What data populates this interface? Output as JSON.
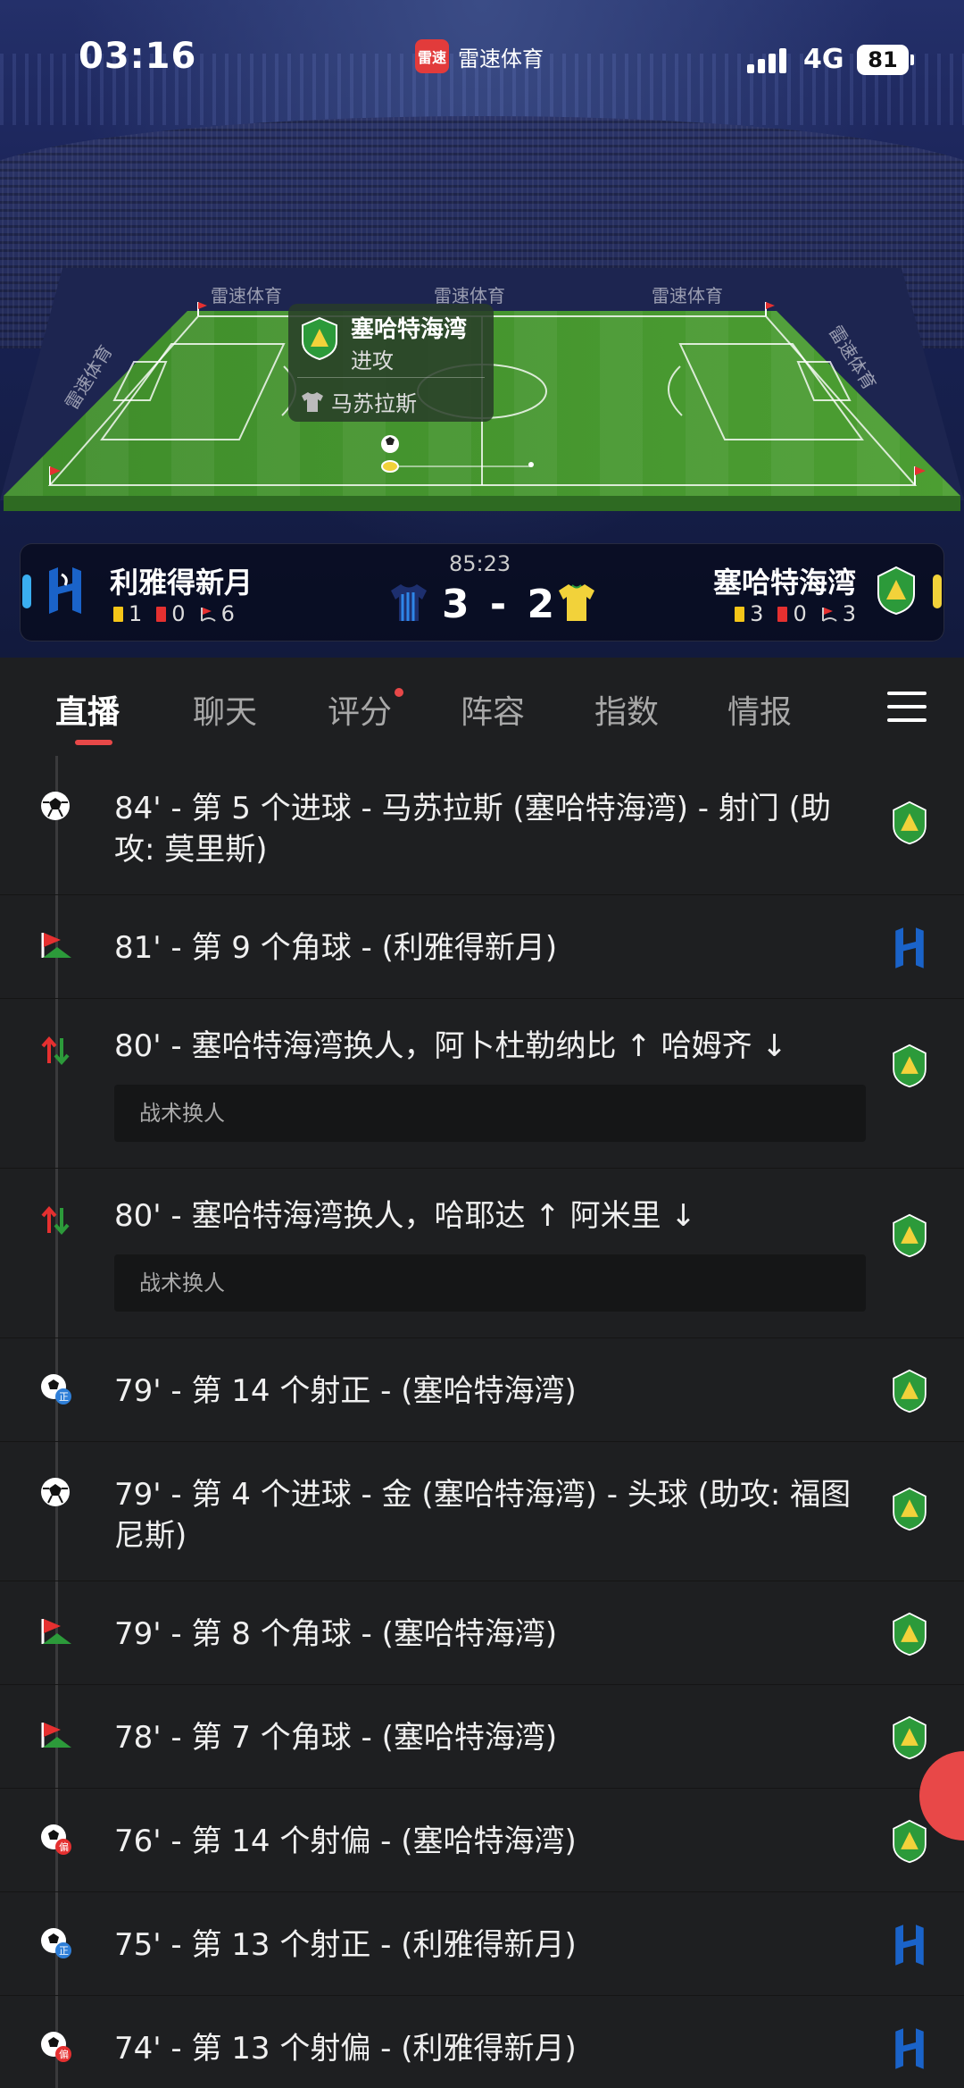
{
  "status_bar": {
    "time": "03:16",
    "app_logo_text": "雷速",
    "app_name": "雷速体育",
    "network": "4G",
    "battery": "81"
  },
  "pitch": {
    "board_ads": [
      "雷速体育",
      "雷速体育",
      "雷速体育",
      "雷速体育",
      "雷速体育"
    ],
    "event_card": {
      "team": "塞哈特海湾",
      "action": "进攻",
      "player": "马苏拉斯"
    }
  },
  "match": {
    "clock": "85:23",
    "score": "3 - 2",
    "home": {
      "name": "利雅得新月",
      "yellow": "1",
      "red": "0",
      "corners": "6",
      "color": "#1a63c9"
    },
    "away": {
      "name": "塞哈特海湾",
      "yellow": "3",
      "red": "0",
      "corners": "3",
      "color": "#f2d23a"
    }
  },
  "tabs": [
    {
      "label": "直播",
      "active": true
    },
    {
      "label": "聊天"
    },
    {
      "label": "评分",
      "has_dot": true
    },
    {
      "label": "阵容"
    },
    {
      "label": "指数"
    },
    {
      "label": "情报"
    }
  ],
  "events": [
    {
      "icon": "goal-icon",
      "text": "84' - 第 5 个进球 - 马苏拉斯 (塞哈特海湾) - 射门 (助攻: 莫里斯)",
      "team": "away"
    },
    {
      "icon": "corner-icon",
      "text": "81' - 第 9 个角球 - (利雅得新月)",
      "team": "home"
    },
    {
      "icon": "substitution-icon",
      "text": "80' - 塞哈特海湾换人，阿卜杜勒纳比 ↑ 哈姆齐 ↓",
      "note": "战术换人",
      "team": "away"
    },
    {
      "icon": "substitution-icon",
      "text": "80' - 塞哈特海湾换人，哈耶达 ↑ 阿米里 ↓",
      "note": "战术换人",
      "team": "away"
    },
    {
      "icon": "shot-on-target-icon",
      "text": "79' - 第 14 个射正 - (塞哈特海湾)",
      "team": "away"
    },
    {
      "icon": "goal-icon",
      "text": "79' - 第 4 个进球 - 金 (塞哈特海湾) - 头球 (助攻: 福图尼斯)",
      "team": "away"
    },
    {
      "icon": "corner-icon",
      "text": "79' - 第 8 个角球 - (塞哈特海湾)",
      "team": "away"
    },
    {
      "icon": "corner-icon",
      "text": "78' - 第 7 个角球 - (塞哈特海湾)",
      "team": "away"
    },
    {
      "icon": "shot-off-target-icon",
      "text": "76' - 第 14 个射偏 - (塞哈特海湾)",
      "team": "away"
    },
    {
      "icon": "shot-on-target-icon",
      "text": "75' - 第 13 个射正 - (利雅得新月)",
      "team": "home"
    },
    {
      "icon": "shot-off-target-icon",
      "text": "74' - 第 13 个射偏 - (利雅得新月)",
      "team": "home"
    }
  ]
}
